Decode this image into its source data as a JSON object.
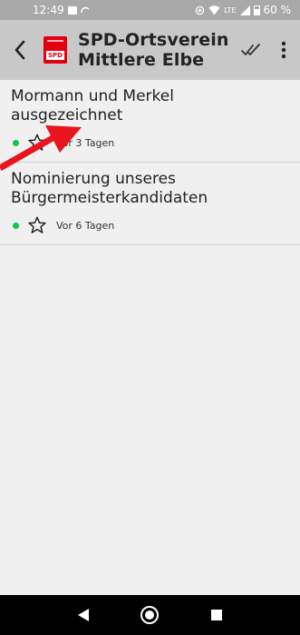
{
  "status_bar": {
    "time": "12:49",
    "battery": "60 %",
    "network": "LTE"
  },
  "app_bar": {
    "title_line1": "SPD-Ortsverein",
    "title_line2": "Mittlere Elbe",
    "logo_text": "SPD",
    "logo_color": "#e3000f",
    "back_icon": "chevron-left-icon",
    "mark_read_icon": "double-check-icon",
    "menu_icon": "more-vertical-icon"
  },
  "items": [
    {
      "title": "Mormann und Merkel ausgezeichnet",
      "date": "Vor 3 Tagen",
      "unread_color": "#17c54a"
    },
    {
      "title": "Nominierung unseres Bürgermeisterkandidaten",
      "date": "Vor 6 Tagen",
      "unread_color": "#17c54a"
    }
  ],
  "nav_bar": {
    "back_icon": "triangle-back-icon",
    "home_icon": "circle-home-icon",
    "recents_icon": "square-recents-icon"
  },
  "annotation_color": "#e8141e"
}
